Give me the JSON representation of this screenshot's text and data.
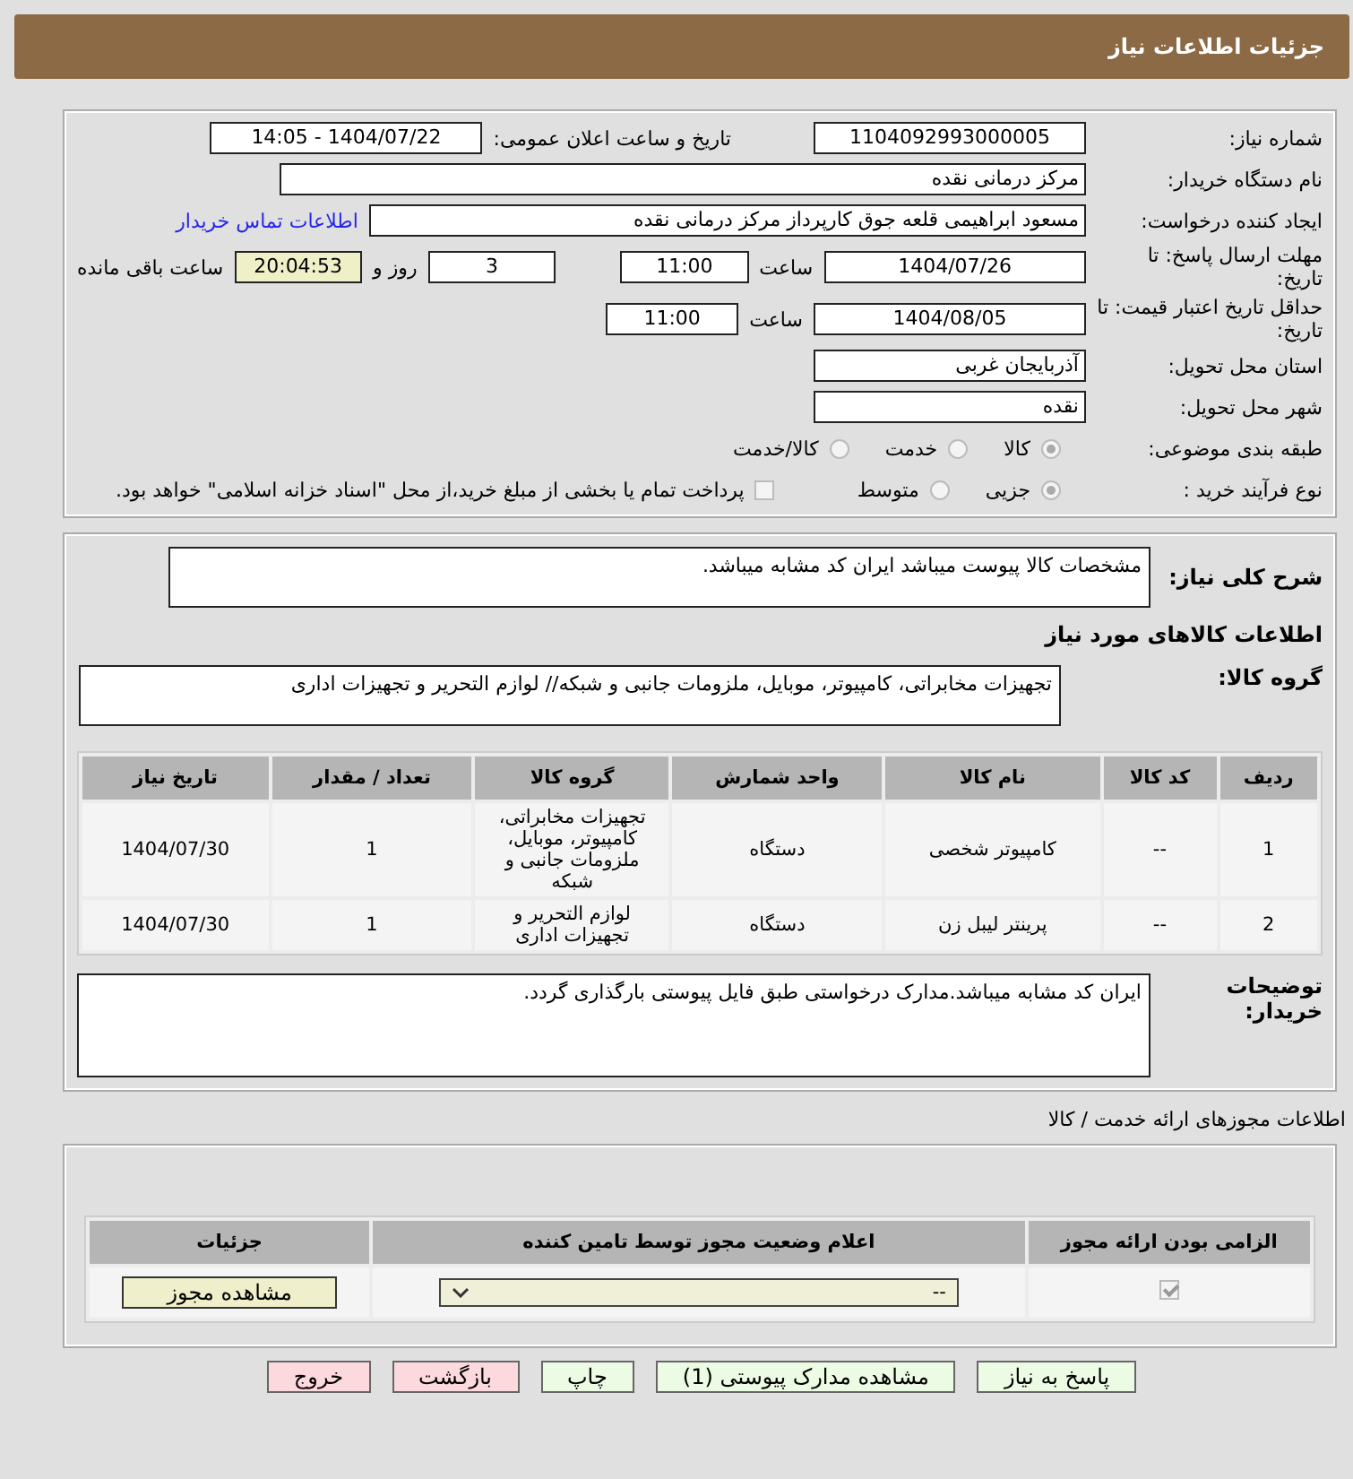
{
  "header": {
    "title": "جزئیات اطلاعات نیاز"
  },
  "form": {
    "need_number": {
      "label": "شماره نیاز:",
      "value": "1104092993000005"
    },
    "announce": {
      "label": "تاریخ و ساعت اعلان عمومی:",
      "value": "1404/07/22 - 14:05"
    },
    "buyer": {
      "label": "نام دستگاه خریدار:",
      "value": "مرکز درمانی نقده"
    },
    "creator": {
      "label": "ایجاد کننده درخواست:",
      "value": "مسعود ابراهیمی قلعه جوق کارپرداز مرکز درمانی نقده",
      "link": "اطلاعات تماس خریدار"
    },
    "deadline": {
      "label": "مهلت ارسال پاسخ: تا تاریخ:",
      "date": "1404/07/26",
      "time_label": "ساعت",
      "time": "11:00",
      "days": "3",
      "days_label": "روز و",
      "remaining": "20:04:53",
      "remaining_label": "ساعت باقی مانده"
    },
    "validity": {
      "label": "حداقل تاریخ اعتبار قیمت: تا تاریخ:",
      "date": "1404/08/05",
      "time_label": "ساعت",
      "time": "11:00"
    },
    "province": {
      "label": "استان محل تحویل:",
      "value": "آذربایجان غربی"
    },
    "city": {
      "label": "شهر محل تحویل:",
      "value": "نقده"
    },
    "category": {
      "label": "طبقه بندی موضوعی:",
      "options": [
        {
          "label": "کالا",
          "selected": true
        },
        {
          "label": "خدمت",
          "selected": false
        },
        {
          "label": "کالا/خدمت",
          "selected": false
        }
      ]
    },
    "process": {
      "label": "نوع فرآیند خرید :",
      "options": [
        {
          "label": "جزیی",
          "selected": true
        },
        {
          "label": "متوسط",
          "selected": false
        }
      ],
      "payment": {
        "label": "پرداخت تمام یا بخشی از مبلغ خرید،از محل \"اسناد خزانه اسلامی\" خواهد بود.",
        "checked": false
      }
    }
  },
  "description": {
    "label": "شرح کلی نیاز:",
    "value": "مشخصات کالا پیوست میباشد ایران کد مشابه میباشد."
  },
  "goods_title": "اطلاعات کالاهای مورد نیاز",
  "goods_group": {
    "label": "گروه کالا:",
    "value": "تجهیزات مخابراتی، کامپیوتر، موبایل، ملزومات جانبی و شبکه// لوازم التحریر و تجهیزات اداری"
  },
  "table": {
    "columns": [
      "ردیف",
      "کد کالا",
      "نام کالا",
      "واحد شمارش",
      "گروه کالا",
      "تعداد / مقدار",
      "تاریخ نیاز"
    ],
    "rows": [
      [
        "1",
        "--",
        "کامپیوتر شخصی",
        "دستگاه",
        "تجهیزات مخابراتی، کامپیوتر، موبایل، ملزومات جانبی و شبکه",
        "1",
        "1404/07/30"
      ],
      [
        "2",
        "--",
        "پرینتر لیبل زن",
        "دستگاه",
        "لوازم التحریر و تجهیزات اداری",
        "1",
        "1404/07/30"
      ]
    ]
  },
  "buyer_notes": {
    "label": "توضیحات خریدار:",
    "value": "ایران کد مشابه میباشد.مدارک درخواستی طبق فایل پیوستی بارگذاری  گردد."
  },
  "license": {
    "title": "اطلاعات مجوزهای ارائه خدمت / کالا",
    "columns": [
      "الزامی بودن ارائه مجوز",
      "اعلام وضعیت مجوز توسط تامین کننده",
      "جزئیات"
    ],
    "rows": [
      {
        "required": true,
        "status": "--",
        "button": "مشاهده مجوز"
      }
    ]
  },
  "buttons": [
    {
      "label": "پاسخ به نیاز",
      "kind": "ok"
    },
    {
      "label": "مشاهده مدارک پیوستی (1)",
      "kind": "ok"
    },
    {
      "label": "چاپ",
      "kind": "ok"
    },
    {
      "label": "بازگشت",
      "kind": "cancel"
    },
    {
      "label": "خروج",
      "kind": "cancel"
    }
  ]
}
